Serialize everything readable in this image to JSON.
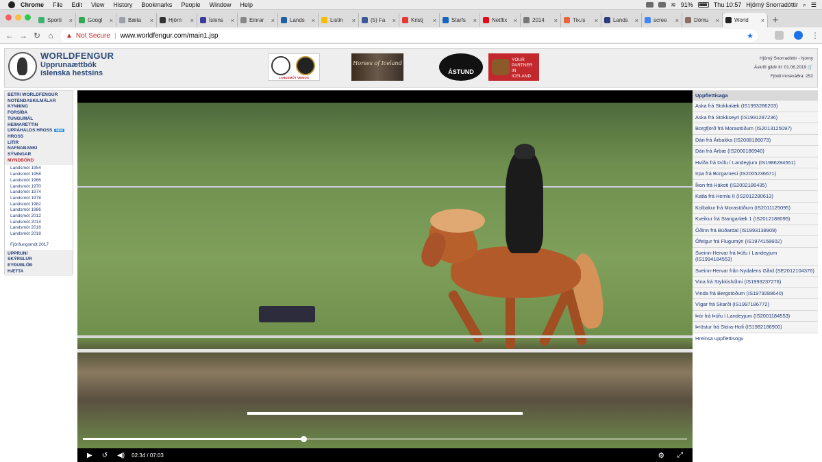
{
  "mac_menu": {
    "items": [
      "Chrome",
      "File",
      "Edit",
      "View",
      "History",
      "Bookmarks",
      "People",
      "Window",
      "Help"
    ],
    "status": {
      "battery": "91%",
      "time": "Thu 10:57",
      "user": "Hjörný Snorradóttir"
    }
  },
  "tabs": [
    {
      "label": "Sporti",
      "color": "#3cb371"
    },
    {
      "label": "Googl",
      "color": "#34a853"
    },
    {
      "label": "Bæta",
      "color": "#9aa0a6"
    },
    {
      "label": "Hjörn",
      "color": "#333333"
    },
    {
      "label": "Íslens",
      "color": "#3b3b9e"
    },
    {
      "label": "Einrar",
      "color": "#888888"
    },
    {
      "label": "Lands",
      "color": "#1f5fa8"
    },
    {
      "label": "Listin",
      "color": "#fbbc04"
    },
    {
      "label": "(5) Fa",
      "color": "#3b5998"
    },
    {
      "label": "Kristj",
      "color": "#e53935"
    },
    {
      "label": "Starfs",
      "color": "#1565c0"
    },
    {
      "label": "Netflix",
      "color": "#e50914"
    },
    {
      "label": "2014",
      "color": "#777777"
    },
    {
      "label": "Tix.is",
      "color": "#e8643c"
    },
    {
      "label": "Lands",
      "color": "#2c3e7a"
    },
    {
      "label": "scree",
      "color": "#4285f4"
    },
    {
      "label": "Dómu",
      "color": "#8d6e63"
    },
    {
      "label": "World",
      "color": "#222222",
      "active": true
    }
  ],
  "address_bar": {
    "security": "Not Secure",
    "url": "www.worldfengur.com/main1.jsp"
  },
  "header": {
    "brand_title": "WORLDFENGUR",
    "brand_line1": "Upprunaættbók",
    "brand_line2": "íslenska hestsins",
    "ad1_text": "LANDSMÓT VIDEOS",
    "ad2_text": "Horses of Iceland",
    "ad3_text": "ÁSTUND",
    "ad4_text": "YOUR PARTNER IN ICELAND",
    "user": "Hjörný Snorradóttir - hjorny",
    "subscription": "Áskrift gildir til: 01.06.2019",
    "login_count": "Fjöldi innskráðra: 252"
  },
  "nav": {
    "group1": [
      "BETRI WORLDFENGUR",
      "NOTENDASKILMÁLAR",
      "KYNNING",
      "FORSÍÐA",
      "TUNGUMÁL",
      "HEIMARÉTTIN"
    ],
    "favorites": "UPPÁHALDS HROSS",
    "new_badge": "NEW",
    "group1b": [
      "HROSS",
      "LITIR",
      "NAFNABANKI",
      "SÝNINGAR"
    ],
    "active": "MYNDBÖND",
    "videos": [
      "Landsmót 1954",
      "Landsmót 1958",
      "Landsmót 1966",
      "Landsmót 1970",
      "Landsmót 1974",
      "Landsmót 1978",
      "Landsmót 1982",
      "Landsmót 1986",
      "Landsmót 2012",
      "Landsmót 2014",
      "Landsmót 2016",
      "Landsmót 2018"
    ],
    "extra_video": "Fjórðungsmót 2017",
    "group2": [
      "UPPRUNI",
      "SKÝRSLUR",
      "EYÐUBLÖÐ",
      "HÆTTA"
    ]
  },
  "video": {
    "current_time": "02:34",
    "separator": "/",
    "duration": "07:03",
    "progress": 0.365
  },
  "history": {
    "title": "Uppflettisaga",
    "items": [
      "Aska frá Stokkalæk (IS1993286203)",
      "Aska frá Stokkseyri (IS1991287236)",
      "Borgfjörð frá Morastöðum (IS2013125097)",
      "Dári frá Árbakka (IS2008186073)",
      "Dári frá Árbæ (IS2000186940)",
      "Hviða frá Þúfu í Landeyjum (IS1986284551)",
      "Irpa frá Borgarnesi (IS2005236671)",
      "Íkon frá Hákoti (IS2002186435)",
      "Katla frá Hemlu II (IS2012280613)",
      "Kolbakur frá Morastöðum (IS2011125095)",
      "Kveikur frá Stangarlæk 1 (IS2012188095)",
      "Óðinn frá Búðardal (IS1993138909)",
      "Ófeigur frá Flugumýri (IS1974158602)",
      "Sveinn-Hervar frá Þúfu í Landeyjum (IS1994184553)",
      "Sveinn-Hervar från Nydalens Gård (SE2012104376)",
      "Vina frá Stykkishólmi (IS1993237276)",
      "Vinda frá Bergstöðum (IS1979288640)",
      "Vígar frá Skarði (IS1997186772)",
      "Þór frá Þúfu í Landeyjum (IS2001184553)",
      "Þröstur frá Stóra-Hofi (IS1982186900)"
    ],
    "clear": "Hreinsa uppflettisögu"
  }
}
